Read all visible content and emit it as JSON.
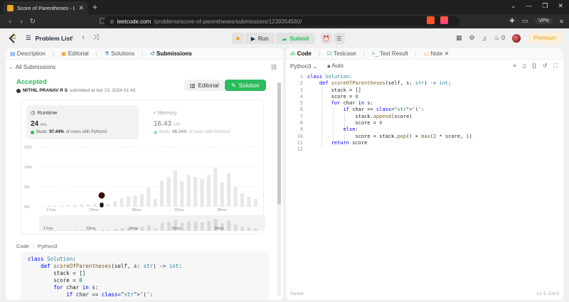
{
  "browser": {
    "tab_title": "Score of Parentheses - LeetCode",
    "url_host": "leetcode.com",
    "url_path": "/problems/score-of-parentheses/submissions/1239354560/",
    "vpn_label": "VPN"
  },
  "header": {
    "problem_list": "Problem List",
    "run_label": "Run",
    "submit_label": "Submit",
    "streak_count": "0",
    "premium_label": "Premium"
  },
  "left_tabs": [
    {
      "label": "Description",
      "icon": "description-icon"
    },
    {
      "label": "Editorial",
      "icon": "editorial-icon"
    },
    {
      "label": "Solutions",
      "icon": "solutions-icon"
    },
    {
      "label": "Submissions",
      "icon": "submissions-icon"
    }
  ],
  "submission": {
    "back_label": "All Submissions",
    "status": "Accepted",
    "user": "MITHIL PRANAV R S",
    "submitted_text": "submitted at Apr 23, 2024 01:43",
    "editorial_btn": "Editorial",
    "solution_btn": "Solution",
    "runtime": {
      "label": "Runtime",
      "value": "24",
      "unit": "ms",
      "beats_prefix": "Beats",
      "beats_pct": "97.44%",
      "beats_suffix": "of users with Python3"
    },
    "memory": {
      "label": "Memory",
      "value": "16.43",
      "unit": "MB",
      "beats_prefix": "Beats",
      "beats_pct": "68.34%",
      "beats_suffix": "of users with Python3"
    }
  },
  "chart_data": {
    "type": "bar",
    "yticks": [
      "15%",
      "10%",
      "5%",
      "0%"
    ],
    "ylim": [
      0,
      15
    ],
    "xticks": [
      "17ms",
      "23ms",
      "28ms",
      "33ms",
      "38ms"
    ],
    "minimap_ticks": [
      "17ms",
      "23ms",
      "28ms",
      "33ms",
      "38ms"
    ],
    "values": [
      0.2,
      0.3,
      0.3,
      0.4,
      0.5,
      0.6,
      0.7,
      0.8,
      1.0,
      0.7,
      1.5,
      2.2,
      2.6,
      2.8,
      3.2,
      4.8,
      2.0,
      6.5,
      7.5,
      9.2,
      6.5,
      8.0,
      7.5,
      7.0,
      8.0,
      9.8,
      6.2,
      8.5,
      5.0,
      3.5,
      2.5,
      2.0
    ],
    "highlight_index": 8
  },
  "code_section": {
    "label": "Code",
    "lang": "Python3",
    "lines": [
      "class Solution:",
      "    def scoreOfParentheses(self, s: str) -> int:",
      "        stack = []",
      "        score = 0",
      "        for char in s:",
      "            if char == '(':"
    ]
  },
  "editor": {
    "tabs": [
      "Code",
      "Testcase",
      "Test Result",
      "Note"
    ],
    "language": "Python3",
    "mode": "Auto",
    "line_numbers": [
      "1",
      "2",
      "3",
      "4",
      "5",
      "6",
      "7",
      "8",
      "9",
      "10",
      "11",
      "12"
    ],
    "code": [
      "class Solution:",
      "    def scoreOfParentheses(self, s: str) -> int:",
      "        stack = []",
      "        score = 0",
      "        for char in s:",
      "            if char == '(':",
      "                stack.append(score)",
      "                score = 0",
      "            else:",
      "                score = stack.pop() + max(2 * score, 1)",
      "        return score",
      ""
    ],
    "footer_left": "Saved",
    "footer_right": "Ln 3, Col 9"
  },
  "colors": {
    "accent": "#2cbb5d",
    "premium": "#e7a42b"
  }
}
